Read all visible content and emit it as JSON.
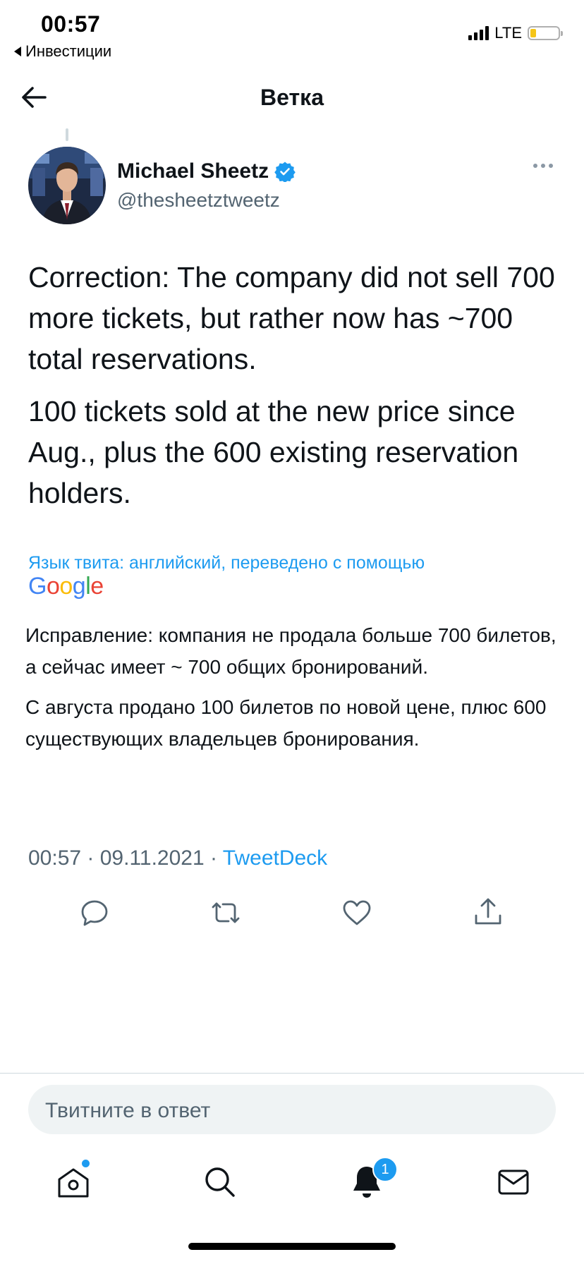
{
  "status_bar": {
    "time": "00:57",
    "back_app": "Инвестиции",
    "network": "LTE",
    "icons": [
      "signal-icon",
      "battery-icon"
    ]
  },
  "header": {
    "title": "Ветка",
    "back_icon": "arrow-left-icon"
  },
  "tweet": {
    "author_name": "Michael Sheetz",
    "verified": true,
    "handle": "@thesheetztweetz",
    "paragraphs": [
      "Correction: The company did not sell 700 more tickets, but rather now has ~700 total reservations.",
      "100 tickets sold at the new price since Aug., plus the 600 existing reservation holders."
    ],
    "translation_note": "Язык твита: английский, переведено с помощью",
    "translation_provider": "Google",
    "translated_paragraphs": [
      "Исправление: компания не продала больше 700 билетов, а сейчас имеет ~ 700 общих бронирований.",
      " С августа продано 100 билетов по новой цене, плюс 600 существующих владельцев бронирования."
    ],
    "time": "00:57",
    "date": "09.11.2021",
    "source": "TweetDeck",
    "separator": " · "
  },
  "actions": [
    "reply-icon",
    "retweet-icon",
    "like-icon",
    "share-icon"
  ],
  "reply_box": {
    "placeholder": "Твитните в ответ"
  },
  "tab_bar": {
    "items": [
      "home-icon",
      "search-icon",
      "notifications-icon",
      "messages-icon"
    ],
    "notifications_badge": "1"
  },
  "colors": {
    "accent": "#1d9bf0",
    "text": "#0f1419",
    "secondary": "#536471"
  }
}
